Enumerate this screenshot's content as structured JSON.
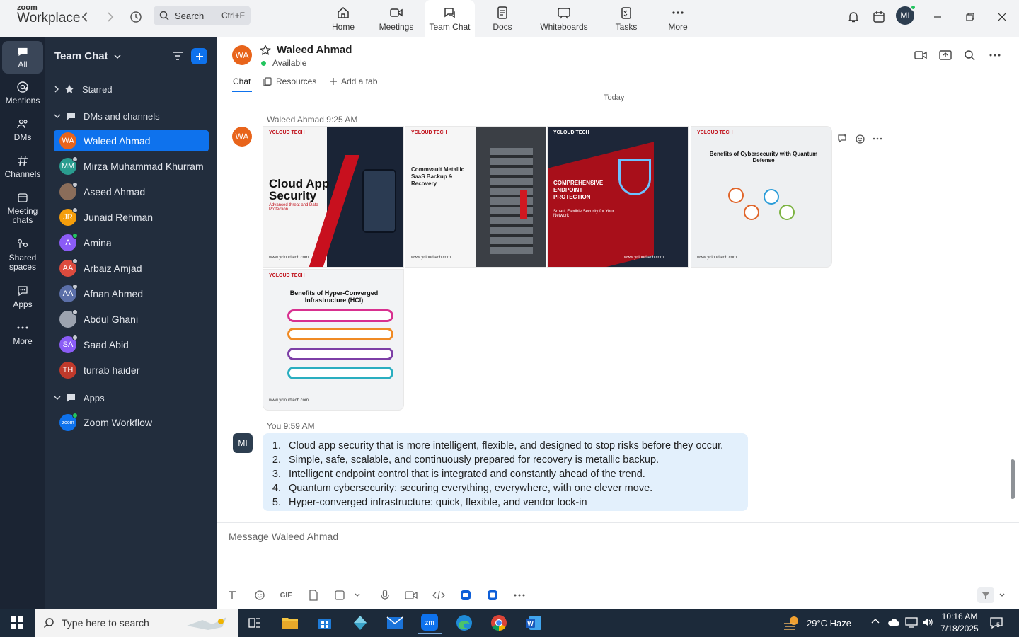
{
  "app": {
    "logo_line1": "zoom",
    "logo_line2": "Workplace"
  },
  "top_search": {
    "label": "Search",
    "shortcut": "Ctrl+F"
  },
  "top_tabs": [
    {
      "label": "Home",
      "icon": "home-icon"
    },
    {
      "label": "Meetings",
      "icon": "video-icon"
    },
    {
      "label": "Team Chat",
      "icon": "chat-icon",
      "active": true
    },
    {
      "label": "Docs",
      "icon": "doc-icon"
    },
    {
      "label": "Whiteboards",
      "icon": "whiteboard-icon"
    },
    {
      "label": "Tasks",
      "icon": "tasks-icon"
    },
    {
      "label": "More",
      "icon": "more-icon"
    }
  ],
  "user_avatar": "MI",
  "rail": [
    {
      "label": "All",
      "icon": "chat-icon",
      "active": true
    },
    {
      "label": "Mentions",
      "icon": "at-icon"
    },
    {
      "label": "DMs",
      "icon": "people-icon"
    },
    {
      "label": "Channels",
      "icon": "hash-icon"
    },
    {
      "label": "Meeting chats",
      "icon": "calendar-icon"
    },
    {
      "label": "Shared spaces",
      "icon": "share-icon"
    },
    {
      "label": "Apps",
      "icon": "apps-icon"
    },
    {
      "label": "More",
      "icon": "more-icon"
    }
  ],
  "sidebar": {
    "title": "Team Chat",
    "sections": {
      "starred": "Starred",
      "dms": "DMs and channels",
      "apps": "Apps"
    },
    "contacts": [
      {
        "initials": "WA",
        "name": "Waleed Ahmad",
        "color": "#e8641b",
        "selected": true,
        "online": false
      },
      {
        "initials": "MM",
        "name": "Mirza Muhammad Khurram",
        "color": "#2a9d8f",
        "online": false
      },
      {
        "initials": "",
        "name": "Aseed Ahmad",
        "color": "#8a6d5a",
        "online": false
      },
      {
        "initials": "JR",
        "name": "Junaid Rehman",
        "color": "#f59e0b",
        "online": false
      },
      {
        "initials": "A",
        "name": "Amina",
        "color": "#8b5cf6",
        "online": true
      },
      {
        "initials": "AA",
        "name": "Arbaiz Amjad",
        "color": "#dc4b3e",
        "online": false
      },
      {
        "initials": "AA",
        "name": "Afnan Ahmed",
        "color": "#5b6fa8",
        "online": false
      },
      {
        "initials": "",
        "name": "Abdul Ghani",
        "color": "#9ca3af",
        "online": false
      },
      {
        "initials": "SA",
        "name": "Saad Abid",
        "color": "#8b5cf6",
        "online": false
      },
      {
        "initials": "TH",
        "name": "turrab haider",
        "color": "#c0392b",
        "online": false
      }
    ],
    "apps": [
      {
        "initials": "zoom",
        "name": "Zoom Workflow",
        "color": "#0e72ed",
        "online": true
      }
    ]
  },
  "chat_header": {
    "initials": "WA",
    "name": "Waleed Ahmad",
    "status": "Available"
  },
  "chat_tabs": {
    "chat": "Chat",
    "resources": "Resources",
    "add": "Add a tab"
  },
  "day_divider": "Today",
  "messages": [
    {
      "sender": "Waleed Ahmad",
      "time": "9:25 AM",
      "initials": "WA",
      "images": [
        {
          "brand": "YCLOUD TECH",
          "title": "Cloud App Security",
          "subtitle": "Advanced threat and Data Protection",
          "site": "www.ycloudtech.com"
        },
        {
          "brand": "YCLOUD TECH",
          "title": "Commvault Metallic SaaS Backup & Recovery",
          "subtitle": "",
          "site": "www.ycloudtech.com"
        },
        {
          "brand": "YCLOUD TECH",
          "title": "COMPREHENSIVE ENDPOINT PROTECTION",
          "subtitle": "Smart, Flexible Security for Your Network",
          "site": "www.ycloudtech.com"
        },
        {
          "brand": "YCLOUD TECH",
          "title": "Benefits of Cybersecurity with Quantum Defense",
          "subtitle": "",
          "site": "www.ycloudtech.com"
        },
        {
          "brand": "YCLOUD TECH",
          "title": "Benefits of Hyper-Converged Infrastructure (HCI)",
          "subtitle": "",
          "site": "www.ycloudtech.com"
        }
      ]
    },
    {
      "sender": "You",
      "time": "9:59 AM",
      "initials": "MI",
      "lines": [
        {
          "n": "1.",
          "text": "Cloud app security that is more intelligent, flexible, and designed to stop risks before they occur."
        },
        {
          "n": "2.",
          "text": "Simple, safe, scalable, and continuously prepared for recovery is metallic backup."
        },
        {
          "n": "3.",
          "text": "Intelligent endpoint control that is integrated and constantly ahead of the trend."
        },
        {
          "n": "4.",
          "text": "Quantum cybersecurity: securing everything, everywhere, with one clever move."
        },
        {
          "n": "5.",
          "text": "Hyper-converged infrastructure: quick, flexible, and vendor lock-in"
        }
      ]
    }
  ],
  "composer": {
    "placeholder": "Message Waleed Ahmad",
    "gif": "GIF"
  },
  "taskbar": {
    "search_placeholder": "Type here to search",
    "weather": "29°C  Haze",
    "time": "10:16 AM",
    "date": "7/18/2025",
    "notif_count": "5"
  },
  "colors": {
    "accent": "#0e72ed",
    "rail": "#1b2433",
    "sidebar": "#222d3d",
    "bubble": "#e3f0fc"
  }
}
